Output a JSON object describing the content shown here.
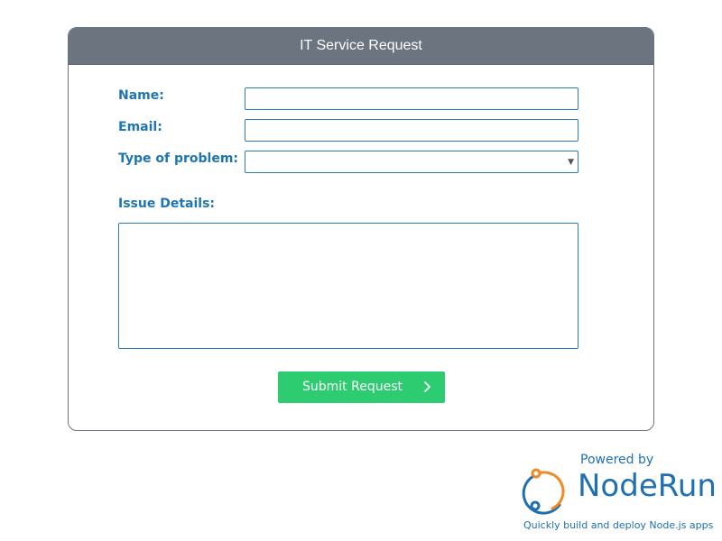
{
  "form": {
    "title": "IT Service Request",
    "fields": {
      "name": {
        "label": "Name:",
        "value": "",
        "placeholder": ""
      },
      "email": {
        "label": "Email:",
        "value": "",
        "placeholder": ""
      },
      "problem_type": {
        "label": "Type of problem:",
        "selected": ""
      },
      "details": {
        "label": "Issue Details:",
        "value": "",
        "placeholder": ""
      }
    },
    "submit_label": "Submit Request"
  },
  "branding": {
    "powered_by": "Powered by",
    "name": "NodeRun",
    "tagline": "Quickly build and deploy Node.js apps",
    "logo_icon": "noderun-logo-icon"
  },
  "colors": {
    "header_bg": "#6c7480",
    "label": "#1f75b3",
    "input_border": "#2a7ab8",
    "submit_bg": "#2ecc71",
    "brand_blue": "#1f6fb2",
    "brand_orange": "#f08a24"
  }
}
